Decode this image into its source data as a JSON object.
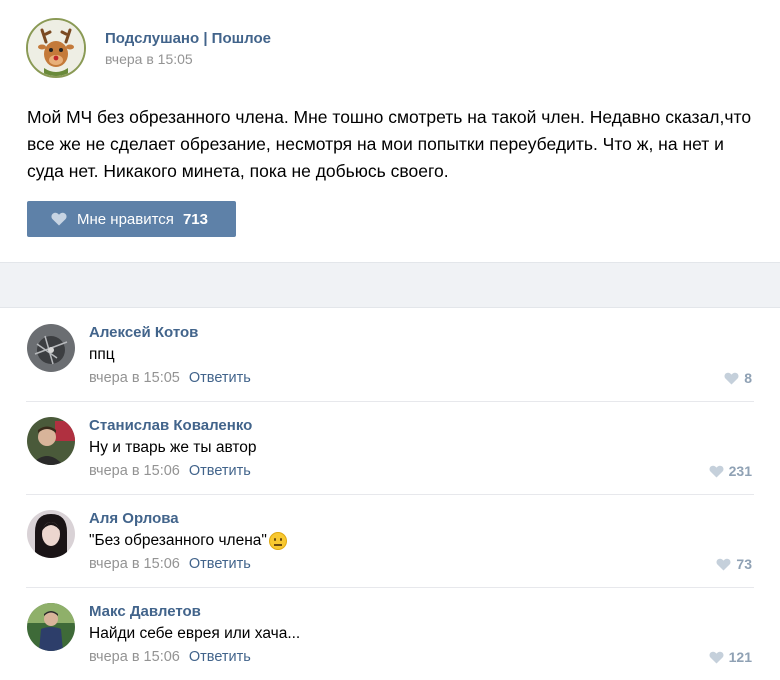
{
  "post": {
    "group_name": "Подслушано | Пошлое",
    "time": "вчера в 15:05",
    "text": "Мой МЧ без обрезанного члена. Мне тошно смотреть на такой член. Недавно сказал,что все же не сделает обрезание, несмотря на мои попытки переубедить. Что ж, на нет и суда нет. Никакого минета, пока не добьюсь своего.",
    "like_label": "Мне нравится",
    "like_count": "713",
    "avatar_icon": "deer-avatar-icon"
  },
  "comments": [
    {
      "name": "Алексей Котов",
      "text": "ппц",
      "time": "вчера в 15:05",
      "reply": "Ответить",
      "likes": "8",
      "avatar_color": "#6b6e72"
    },
    {
      "name": "Станислав Коваленко",
      "text": "Ну и тварь же ты автор",
      "time": "вчера в 15:06",
      "reply": "Ответить",
      "likes": "231",
      "avatar_color": "#4a5a3a"
    },
    {
      "name": "Аля Орлова",
      "text": "\"Без обрезанного члена\"",
      "time": "вчера в 15:06",
      "reply": "Ответить",
      "likes": "73",
      "avatar_color": "#d9d2d6",
      "emoji": "neutral-face-icon"
    },
    {
      "name": "Макс Давлетов",
      "text": "Найди себе еврея или хача...",
      "time": "вчера в 15:06",
      "reply": "Ответить",
      "likes": "121",
      "avatar_color": "#3e6a38"
    }
  ],
  "colors": {
    "link": "#42648b",
    "like_button": "#5e81a8",
    "meta": "#939393",
    "like_count": "#8fa1b4"
  }
}
